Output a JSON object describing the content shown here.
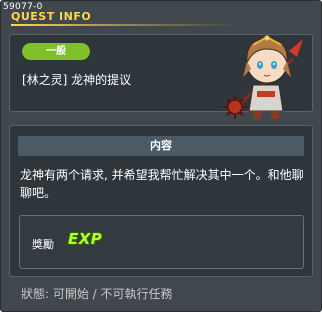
{
  "window": {
    "code": "59077-0",
    "title": "QUEST INFO"
  },
  "quest": {
    "category": "一般",
    "name": "[林之灵] 龙神的提议",
    "npc_icon": "npc-character-icon"
  },
  "content": {
    "header": "内容",
    "description": "龙神有两个请求, 并希望我帮忙解决其中一个。和他聊聊吧。"
  },
  "reward": {
    "label": "獎勵",
    "exp_label": "EXP"
  },
  "status": {
    "text": "狀態: 可開始 / 不可執行任務"
  },
  "colors": {
    "title": "#ffd84a",
    "category_bg": "#7fbf2a",
    "exp": "#b6ff2b"
  }
}
